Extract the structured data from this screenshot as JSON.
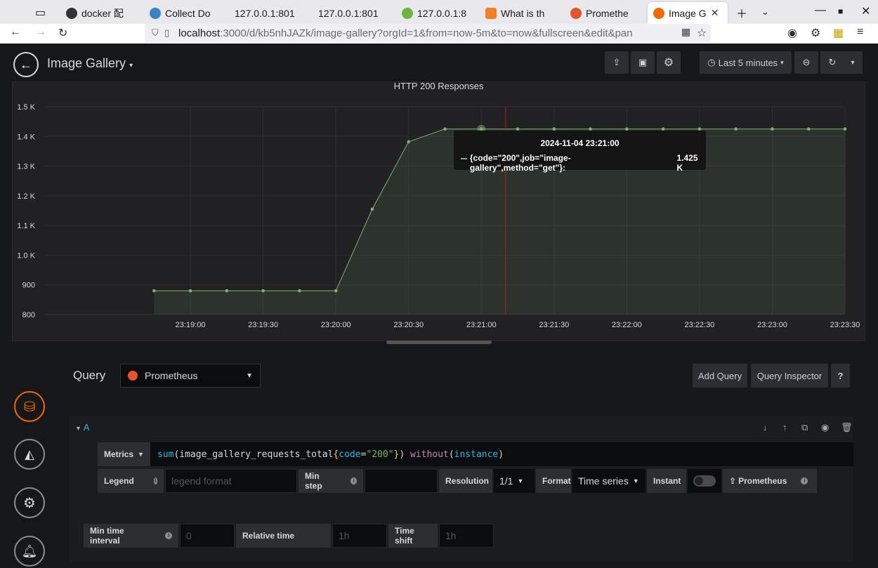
{
  "browser": {
    "tabs": [
      {
        "label": "docker 配"
      },
      {
        "label": "Collect Do"
      },
      {
        "label": "127.0.0.1:801"
      },
      {
        "label": "127.0.0.1:801"
      },
      {
        "label": "127.0.0.1:8"
      },
      {
        "label": "What is th"
      },
      {
        "label": "Promethe"
      },
      {
        "label": "Image G"
      }
    ],
    "url_host": "localhost",
    "url_path": ":3000/d/kb5nhJAZk/image-gallery?orgId=1&from=now-5m&to=now&fullscreen&edit&pan"
  },
  "dashboard": {
    "title": "Image Gallery",
    "time_range": "Last 5 minutes"
  },
  "panel": {
    "title": "HTTP 200 Responses",
    "tooltip": {
      "time": "2024-11-04 23:21:00",
      "series": "{code=\"200\",job=\"image-gallery\",method=\"get\"}:",
      "value": "1.425 K"
    }
  },
  "chart_data": {
    "type": "area",
    "title": "HTTP 200 Responses",
    "x": [
      "23:18:45",
      "23:19:00",
      "23:19:15",
      "23:19:30",
      "23:19:45",
      "23:20:00",
      "23:20:15",
      "23:20:30",
      "23:20:45",
      "23:21:00",
      "23:21:15",
      "23:21:30",
      "23:21:45",
      "23:22:00",
      "23:22:15",
      "23:22:30",
      "23:22:45",
      "23:23:00",
      "23:23:15",
      "23:23:30"
    ],
    "values": [
      880,
      880,
      880,
      880,
      880,
      880,
      1155,
      1382,
      1425,
      1425,
      1425,
      1425,
      1425,
      1425,
      1425,
      1425,
      1425,
      1425,
      1425,
      1425
    ],
    "xticks": [
      "23:19:00",
      "23:19:30",
      "23:20:00",
      "23:20:30",
      "23:21:00",
      "23:21:30",
      "23:22:00",
      "23:22:30",
      "23:23:00",
      "23:23:30"
    ],
    "yticks": [
      "800",
      "900",
      "1.0 K",
      "1.1 K",
      "1.2 K",
      "1.3 K",
      "1.4 K",
      "1.5 K"
    ],
    "ylim": [
      800,
      1500
    ],
    "series_color": "#7eb26d",
    "grid": true,
    "cursor_x": "23:21:10"
  },
  "query": {
    "heading": "Query",
    "datasource": "Prometheus",
    "add_query": "Add Query",
    "inspector": "Query Inspector",
    "help": "?",
    "ref_id": "A",
    "metrics_label": "Metrics",
    "expr_fn": "sum",
    "expr_metric": "image_gallery_requests_total",
    "expr_label_key": "code",
    "expr_label_val": "\"200\"",
    "expr_without": "without",
    "expr_arg": "instance",
    "legend_label": "Legend",
    "legend_placeholder": "legend format",
    "minstep_label": "Min step",
    "resolution_label": "Resolution",
    "resolution_value": "1/1",
    "format_label": "Format",
    "format_value": "Time series",
    "instant_label": "Instant",
    "prom_link": "Prometheus"
  },
  "options": {
    "min_interval_label": "Min time interval",
    "min_interval_placeholder": "0",
    "relative_label": "Relative time",
    "relative_placeholder": "1h",
    "shift_label": "Time shift",
    "shift_placeholder": "1h"
  }
}
